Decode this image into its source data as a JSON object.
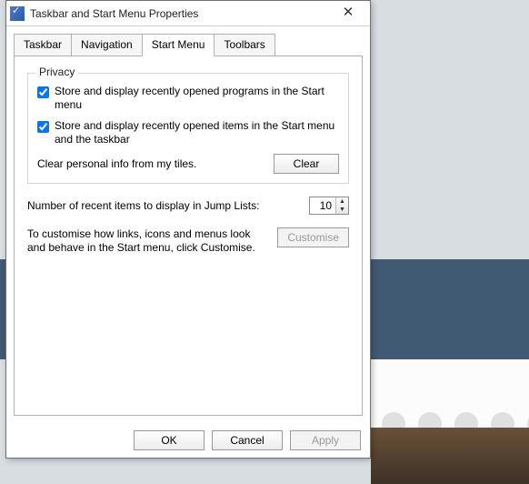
{
  "window": {
    "title": "Taskbar and Start Menu Properties"
  },
  "tabs": {
    "taskbar": "Taskbar",
    "navigation": "Navigation",
    "startmenu": "Start Menu",
    "toolbars": "Toolbars"
  },
  "privacy": {
    "group_label": "Privacy",
    "recent_programs": "Store and display recently opened programs in the Start menu",
    "recent_items": "Store and display recently opened items in the Start menu and the taskbar",
    "clear_text": "Clear personal info from my tiles.",
    "clear_button": "Clear"
  },
  "jump": {
    "label": "Number of recent items to display in Jump Lists:",
    "value": "10"
  },
  "customise": {
    "desc": "To customise how links, icons and menus look and behave in the Start menu, click Customise.",
    "button": "Customise"
  },
  "buttons": {
    "ok": "OK",
    "cancel": "Cancel",
    "apply": "Apply"
  }
}
